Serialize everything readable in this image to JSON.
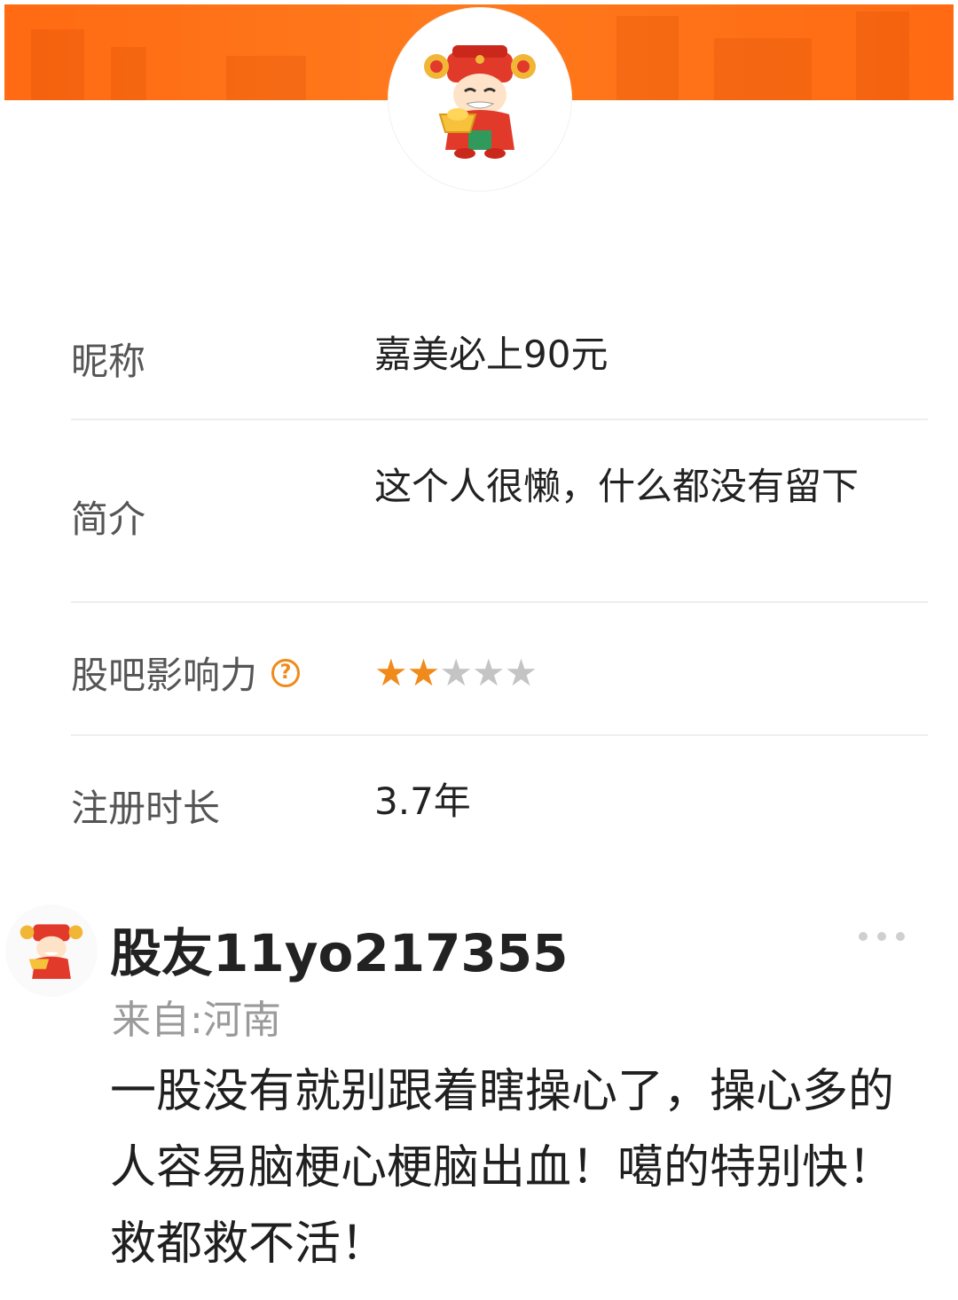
{
  "colors": {
    "brand": "#ff6a12",
    "star_on": "#f08a1a",
    "star_off": "#c4c4c4"
  },
  "header": {
    "avatar_icon": "caishen-mascot-icon"
  },
  "profile": {
    "nickname": {
      "label": "昵称",
      "value": "嘉美必上90元"
    },
    "intro": {
      "label": "简介",
      "value": "这个人很懒，什么都没有留下"
    },
    "influence": {
      "label": "股吧影响力",
      "help_icon": "question-circle-icon",
      "stars_filled": 2,
      "stars_total": 5
    },
    "registered": {
      "label": "注册时长",
      "value": "3.7年"
    }
  },
  "post": {
    "avatar_icon": "caishen-mascot-icon",
    "username": "股友11yo217355",
    "from": "来自:河南",
    "more_icon": "more-dots-icon",
    "body": "一股没有就别跟着瞎操心了，操心多的人容易脑梗心梗脑出血！噶的特别快！救都救不活！"
  }
}
